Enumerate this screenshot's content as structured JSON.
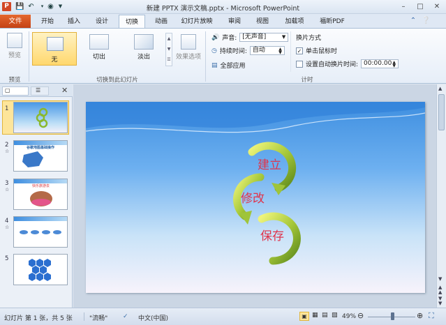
{
  "titlebar": {
    "title": "新建 PPTX 演示文稿.pptx - Microsoft PowerPoint",
    "app_icon": "P"
  },
  "tabs": {
    "file": "文件",
    "items": [
      "开始",
      "插入",
      "设计",
      "切换",
      "动画",
      "幻灯片放映",
      "审阅",
      "视图",
      "加载项",
      "福昕PDF"
    ],
    "active": "切换"
  },
  "ribbon": {
    "preview": {
      "button": "预览",
      "group": "预览"
    },
    "transitions": {
      "none": "无",
      "cut": "切出",
      "fade": "淡出",
      "effect_options": "效果选项",
      "group": "切换到此幻灯片"
    },
    "timing": {
      "sound_label": "声音:",
      "sound_value": "[无声音]",
      "duration_label": "持续时间:",
      "duration_value": "自动",
      "apply_all": "全部应用",
      "advance_title": "换片方式",
      "on_click": "单击鼠标时",
      "on_click_checked": true,
      "after_time": "设置自动换片时间:",
      "after_time_checked": false,
      "time_value": "00:00.00",
      "group": "计时"
    }
  },
  "slides": [
    {
      "num": "1",
      "title": ""
    },
    {
      "num": "2",
      "title": "谷歌地图基础操作"
    },
    {
      "num": "3",
      "title": "快乐旅游去"
    },
    {
      "num": "4",
      "title": ""
    },
    {
      "num": "5",
      "title": ""
    }
  ],
  "slide_content": {
    "labels": [
      "建立",
      "修改",
      "保存"
    ]
  },
  "status": {
    "slide_info": "幻灯片 第 1 张，共 5 张",
    "theme": "\"流畅\"",
    "language": "中文(中国)",
    "zoom": "49%"
  },
  "colors": {
    "file_tab": "#d24726",
    "accent": "#2b5797",
    "arrow_green": "#9cc33a",
    "label_red": "#e0344b"
  }
}
